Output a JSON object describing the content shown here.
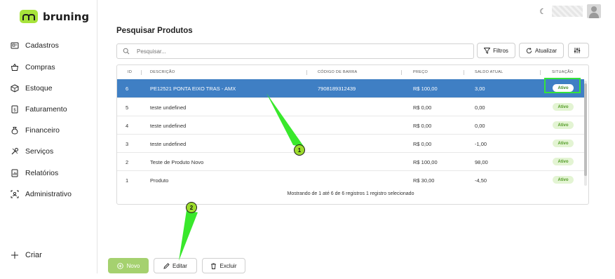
{
  "app": {
    "brand": "bruning"
  },
  "sidebar": {
    "items": [
      {
        "label": "Cadastros",
        "icon": "id-card-icon"
      },
      {
        "label": "Compras",
        "icon": "basket-icon"
      },
      {
        "label": "Estoque",
        "icon": "box-icon"
      },
      {
        "label": "Faturamento",
        "icon": "invoice-icon"
      },
      {
        "label": "Financeiro",
        "icon": "money-bag-icon"
      },
      {
        "label": "Serviços",
        "icon": "tools-icon"
      },
      {
        "label": "Relatórios",
        "icon": "report-icon"
      },
      {
        "label": "Administrativo",
        "icon": "admin-icon"
      }
    ],
    "create_label": "Criar"
  },
  "header": {
    "theme_icon": "moon-icon"
  },
  "page": {
    "title": "Pesquisar Produtos"
  },
  "search": {
    "placeholder": "Pesquisar..."
  },
  "toolbar": {
    "filters_label": "Filtros",
    "refresh_label": "Atualizar"
  },
  "table": {
    "columns": {
      "id": "ID",
      "description": "DESCRIÇÃO",
      "barcode": "CÓDIGO DE BARRA",
      "price": "PREÇO",
      "balance": "SALDO ATUAL",
      "status": "SITUAÇÃO"
    },
    "rows": [
      {
        "id": "6",
        "description": "PE12521 PONTA EIXO TRAS - AMX",
        "barcode": "7908189312439",
        "price": "R$ 100,00",
        "balance": "3,00",
        "status": "Ativo",
        "selected": true
      },
      {
        "id": "5",
        "description": "teste undefined",
        "barcode": "",
        "price": "R$ 0,00",
        "balance": "0,00",
        "status": "Ativo",
        "selected": false
      },
      {
        "id": "4",
        "description": "teste undefined",
        "barcode": "",
        "price": "R$ 0,00",
        "balance": "0,00",
        "status": "Ativo",
        "selected": false
      },
      {
        "id": "3",
        "description": "teste undefined",
        "barcode": "",
        "price": "R$ 0,00",
        "balance": "-1,00",
        "status": "Ativo",
        "selected": false
      },
      {
        "id": "2",
        "description": "Teste de Produto Novo",
        "barcode": "",
        "price": "R$ 100,00",
        "balance": "98,00",
        "status": "Ativo",
        "selected": false
      },
      {
        "id": "1",
        "description": "Produto",
        "barcode": "",
        "price": "R$ 30,00",
        "balance": "-4,50",
        "status": "Ativo",
        "selected": false
      }
    ],
    "footer": "Mostrando de 1 até 6 de 6 registros   1 registro selecionado"
  },
  "actions": {
    "new_label": "Novo",
    "edit_label": "Editar",
    "delete_label": "Excluir"
  },
  "annotations": {
    "callout_1": "1",
    "callout_2": "2"
  },
  "colors": {
    "accent": "#a7e33b",
    "selected_row": "#3f7fc4",
    "status_active": "#4f9a22",
    "annotation": "#35e43a"
  }
}
